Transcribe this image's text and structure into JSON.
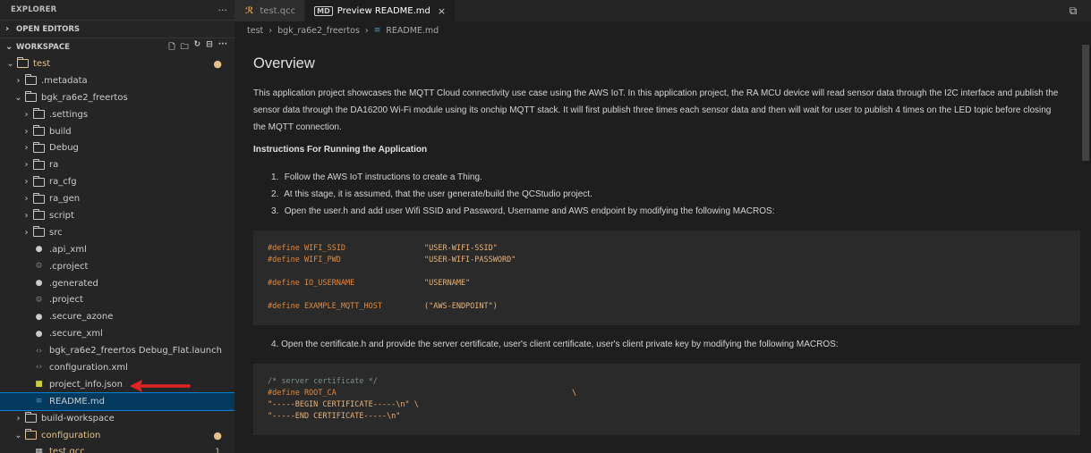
{
  "explorer": {
    "title": "EXPLORER",
    "more": "···",
    "open_editors": "OPEN EDITORS",
    "workspace": "WORKSPACE",
    "workspace_more": "···",
    "tree": [
      {
        "label": "test",
        "depth": 0,
        "type": "folder",
        "expanded": true,
        "color": "yellow",
        "badge": "●"
      },
      {
        "label": ".metadata",
        "depth": 1,
        "type": "folder",
        "expanded": false
      },
      {
        "label": "bgk_ra6e2_freertos",
        "depth": 1,
        "type": "folder",
        "expanded": true
      },
      {
        "label": ".settings",
        "depth": 2,
        "type": "folder",
        "expanded": false
      },
      {
        "label": "build",
        "depth": 2,
        "type": "folder",
        "expanded": false
      },
      {
        "label": "Debug",
        "depth": 2,
        "type": "folder",
        "expanded": false
      },
      {
        "label": "ra",
        "depth": 2,
        "type": "folder",
        "expanded": false
      },
      {
        "label": "ra_cfg",
        "depth": 2,
        "type": "folder",
        "expanded": false
      },
      {
        "label": "ra_gen",
        "depth": 2,
        "type": "folder",
        "expanded": false
      },
      {
        "label": "script",
        "depth": 2,
        "type": "folder",
        "expanded": false
      },
      {
        "label": "src",
        "depth": 2,
        "type": "folder",
        "expanded": false
      },
      {
        "label": ".api_xml",
        "depth": 2,
        "type": "file",
        "icon": "●",
        "icon_color": "#cccccc"
      },
      {
        "label": ".cproject",
        "depth": 2,
        "type": "file",
        "icon": "⚙",
        "icon_color": "#6d8086"
      },
      {
        "label": ".generated",
        "depth": 2,
        "type": "file",
        "icon": "●",
        "icon_color": "#cccccc"
      },
      {
        "label": ".project",
        "depth": 2,
        "type": "file",
        "icon": "⚙",
        "icon_color": "#6d8086"
      },
      {
        "label": ".secure_azone",
        "depth": 2,
        "type": "file",
        "icon": "●",
        "icon_color": "#cccccc"
      },
      {
        "label": ".secure_xml",
        "depth": 2,
        "type": "file",
        "icon": "●",
        "icon_color": "#cccccc"
      },
      {
        "label": "bgk_ra6e2_freertos Debug_Flat.launch",
        "depth": 2,
        "type": "file",
        "icon": "‹›",
        "icon_color": "#8c8c8c"
      },
      {
        "label": "configuration.xml",
        "depth": 2,
        "type": "file",
        "icon": "‹›",
        "icon_color": "#8c8c8c"
      },
      {
        "label": "project_info.json",
        "depth": 2,
        "type": "file",
        "icon": "■",
        "icon_color": "#cbcb41"
      },
      {
        "label": "README.md",
        "depth": 2,
        "type": "file",
        "icon": "≡",
        "icon_color": "#519aba",
        "selected": true
      },
      {
        "label": "build-workspace",
        "depth": 1,
        "type": "folder",
        "expanded": false
      },
      {
        "label": "configuration",
        "depth": 1,
        "type": "folder",
        "expanded": true,
        "color": "yellow",
        "badge": "●"
      },
      {
        "label": "test.qcc",
        "depth": 2,
        "type": "file",
        "icon": "▦",
        "icon_color": "#cccccc",
        "color": "yellow",
        "count": "1"
      }
    ]
  },
  "tabs": [
    {
      "label": "test.qcc",
      "icon": "ℛ",
      "active": false
    },
    {
      "label": "Preview README.md",
      "icon": "MD",
      "active": true,
      "close": "×"
    }
  ],
  "breadcrumb": [
    "test",
    "bgk_ra6e2_freertos",
    "README.md"
  ],
  "preview": {
    "heading": "Overview",
    "intro": "This application project showcases the MQTT Cloud connectivity use case using the AWS IoT. In this application project, the RA MCU device will read sensor data through the I2C interface and publish the sensor data through the DA16200 Wi-Fi module using its onchip MQTT stack. It will first publish three times each sensor data and then will wait for user to publish 4 times on the LED topic before closing the MQTT connection.",
    "instructions_title": "Instructions For Running the Application",
    "steps": [
      {
        "n": "1.",
        "text": "Follow the AWS IoT instructions to create a Thing."
      },
      {
        "n": "2.",
        "text": "At this stage, it is assumed, that the user generate/build the QCStudio project."
      },
      {
        "n": "3.",
        "text": "Open the user.h and add user Wifi SSID and Password, Username and AWS endpoint by modifying the following MACROS:"
      }
    ],
    "code1": [
      {
        "k": "#define WIFI_SSID",
        "v": "\"USER-WIFI-SSID\""
      },
      {
        "k": "#define WIFI_PWD",
        "v": "\"USER-WIFI-PASSWORD\""
      },
      {
        "k": "#define IO_USERNAME",
        "v": "\"USERNAME\""
      },
      {
        "k": "#define EXAMPLE_MQTT_HOST",
        "v": "(\"AWS-ENDPOINT\")"
      }
    ],
    "step4": "4. Open the certificate.h and provide the server certificate, user's client certificate, user's client private key by modifying the following MACROS:",
    "code2": {
      "comment": "/* server certificate */",
      "define": "#define ROOT_CA",
      "backslash": "\\",
      "line3": "\"-----BEGIN CERTIFICATE-----\\n\" \\",
      "line4": "\"-----END CERTIFICATE-----\\n\""
    }
  }
}
